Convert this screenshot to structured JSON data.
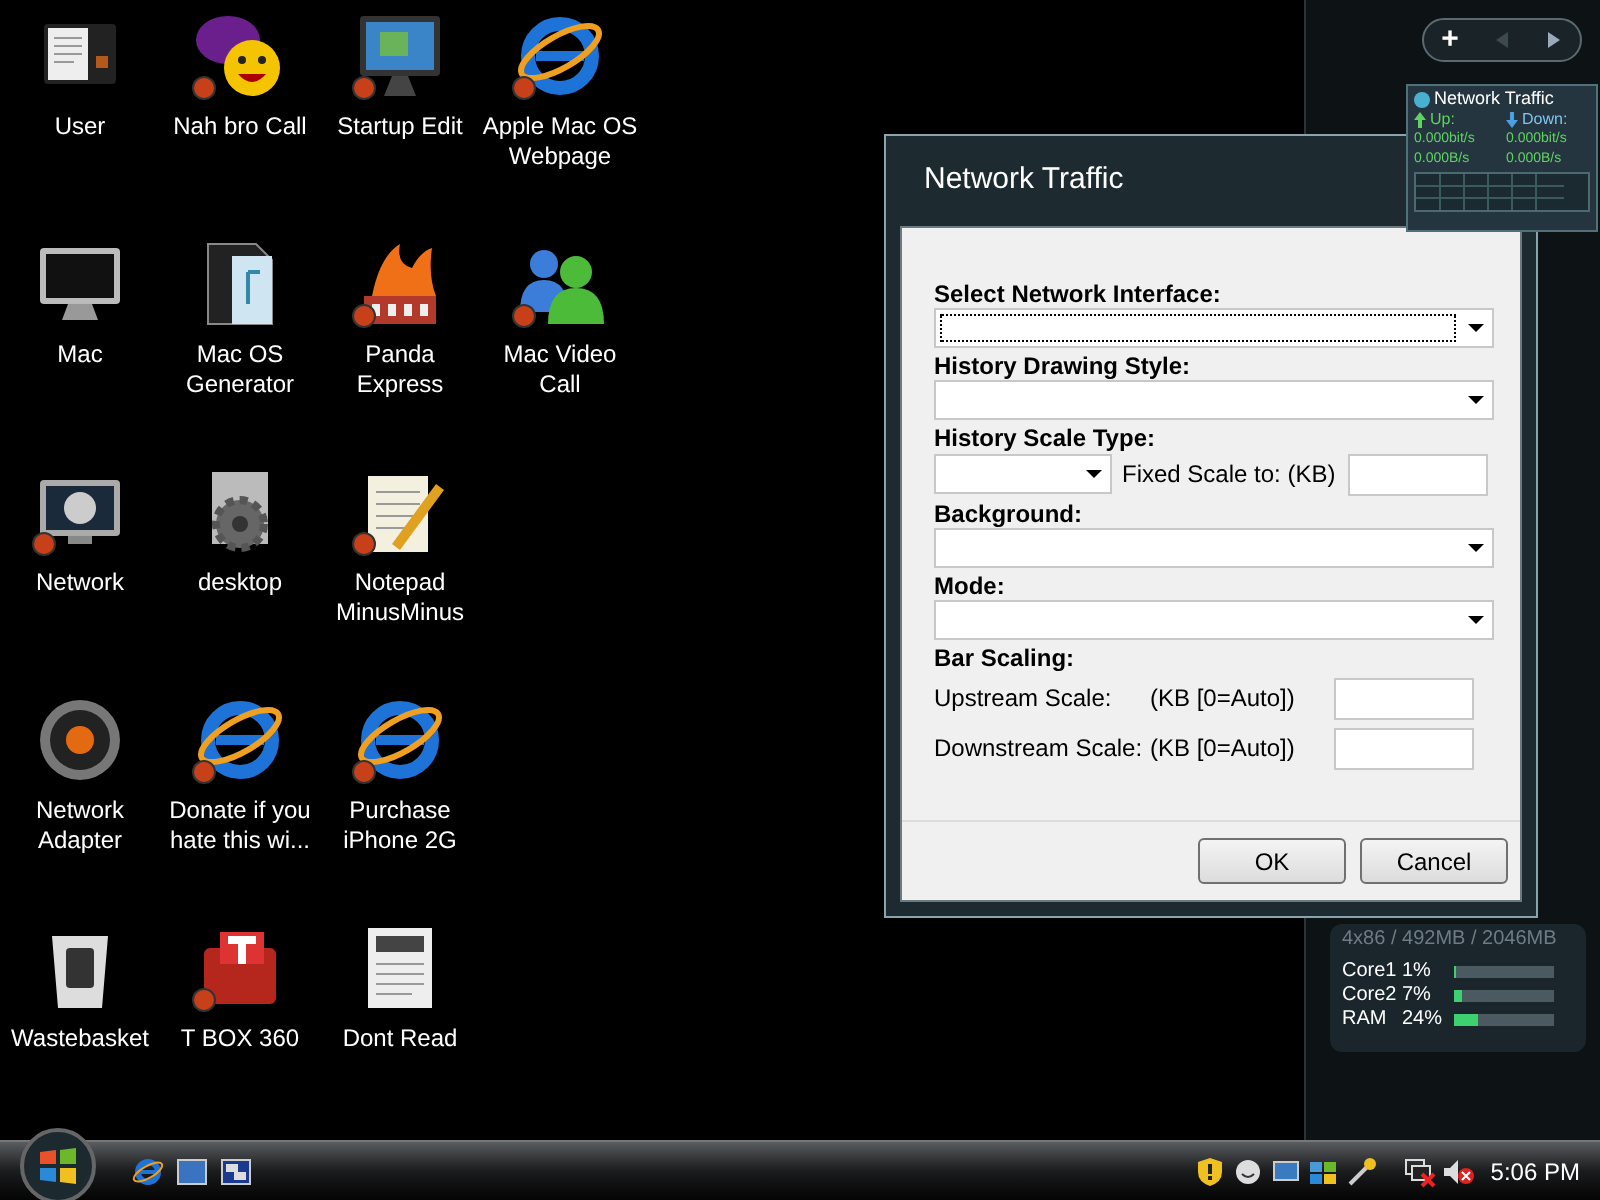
{
  "desktop_icons": [
    {
      "label": "User",
      "kind": "document",
      "shortcut": false
    },
    {
      "label": "Mac",
      "kind": "monitor",
      "shortcut": false
    },
    {
      "label": "Network",
      "kind": "satellite",
      "shortcut": true
    },
    {
      "label": "Network Adapter",
      "kind": "gauge",
      "shortcut": false
    },
    {
      "label": "Wastebasket",
      "kind": "bin",
      "shortcut": false
    },
    {
      "label": "Nah bro Call",
      "kind": "smiley",
      "shortcut": true
    },
    {
      "label": "Mac OS Generator",
      "kind": "folder",
      "shortcut": false
    },
    {
      "label": "desktop",
      "kind": "gear",
      "shortcut": false
    },
    {
      "label": "Donate if you hate this wi...",
      "kind": "browser",
      "shortcut": true
    },
    {
      "label": "T BOX 360",
      "kind": "toolbox",
      "shortcut": true
    },
    {
      "label": "Startup Edit",
      "kind": "screen",
      "shortcut": true
    },
    {
      "label": "Panda Express",
      "kind": "flame",
      "shortcut": true
    },
    {
      "label": "Notepad MinusMinus",
      "kind": "notepad",
      "shortcut": true
    },
    {
      "label": "Purchase iPhone 2G",
      "kind": "browser",
      "shortcut": true
    },
    {
      "label": "Dont Read",
      "kind": "textfile",
      "shortcut": false
    },
    {
      "label": "Apple Mac OS Webpage",
      "kind": "browser",
      "shortcut": true
    },
    {
      "label": "Mac Video Call",
      "kind": "people",
      "shortcut": true
    }
  ],
  "sidebar": {
    "toolbar": {
      "add": "+",
      "prev_disabled": true,
      "next_disabled": false
    },
    "network_gadget": {
      "title": "Network Traffic",
      "up_label": "Up:",
      "down_label": "Down:",
      "up_bits": "0.000bit/s",
      "down_bits": "0.000bit/s",
      "up_bytes": "0.000B/s",
      "down_bytes": "0.000B/s"
    },
    "cpu_gadget": {
      "header": "4x86 / 492MB / 2046MB",
      "meters": [
        {
          "name": "Core1",
          "reading": "1%",
          "level": 0.01
        },
        {
          "name": "Core2",
          "reading": "7%",
          "level": 0.07
        },
        {
          "name": "RAM",
          "reading": "24%",
          "level": 0.24
        }
      ]
    }
  },
  "dialog": {
    "title": "Network Traffic",
    "rows": [
      {
        "kind": "heading",
        "text": "Select Network Interface:"
      },
      {
        "kind": "select",
        "focused": true
      },
      {
        "kind": "heading",
        "text": "History Drawing Style:"
      },
      {
        "kind": "select",
        "focused": false
      },
      {
        "kind": "heading",
        "text": "History Scale Type:"
      },
      {
        "kind": "select_with_field",
        "label": "Fixed Scale to: (KB)"
      },
      {
        "kind": "heading",
        "text": "Background:"
      },
      {
        "kind": "select",
        "focused": false
      },
      {
        "kind": "heading",
        "text": "Mode:"
      },
      {
        "kind": "select",
        "focused": false
      },
      {
        "kind": "heading",
        "text": "Bar Scaling:"
      },
      {
        "kind": "scale_field",
        "label": "Upstream Scale:",
        "unit": "(KB [0=Auto])"
      },
      {
        "kind": "scale_field",
        "label": "Downstream Scale:",
        "unit": "(KB [0=Auto])"
      }
    ],
    "buttons": [
      "OK",
      "Cancel"
    ]
  },
  "taskbar": {
    "quick_launch": [
      {
        "kind": "browser"
      },
      {
        "kind": "desktop"
      },
      {
        "kind": "windows"
      }
    ],
    "tray": [
      {
        "kind": "shield"
      },
      {
        "kind": "messenger"
      },
      {
        "kind": "network"
      },
      {
        "kind": "windows-flag"
      },
      {
        "kind": "wand"
      },
      {
        "kind": "network-off"
      },
      {
        "kind": "speaker-muted"
      }
    ],
    "clock": "5:06 PM"
  }
}
